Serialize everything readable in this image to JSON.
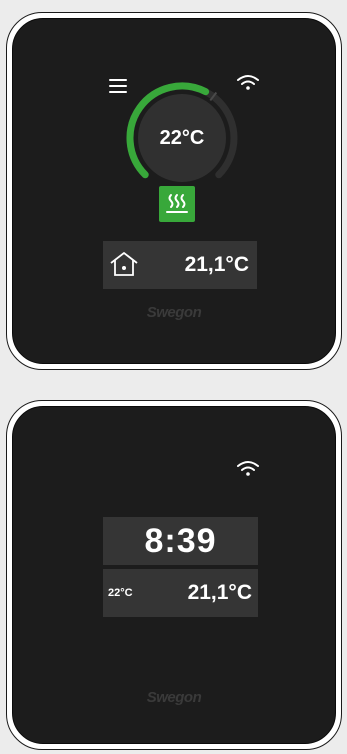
{
  "screen1": {
    "set_temperature": "22°C",
    "indoor_temperature": "21,1°C",
    "brand": "Swegon",
    "setpoint_level": 0.6,
    "icons": {
      "menu": "menu-icon",
      "wifi": "wifi-icon",
      "heating": "heating-icon",
      "home": "home-icon"
    },
    "colors": {
      "accent": "#38a83a",
      "screen": "#1c1c1c",
      "panel": "#353535"
    }
  },
  "screen2": {
    "clock": "8:39",
    "set_temperature": "22°C",
    "indoor_temperature": "21,1°C",
    "brand": "Swegon",
    "icons": {
      "wifi": "wifi-icon"
    }
  }
}
